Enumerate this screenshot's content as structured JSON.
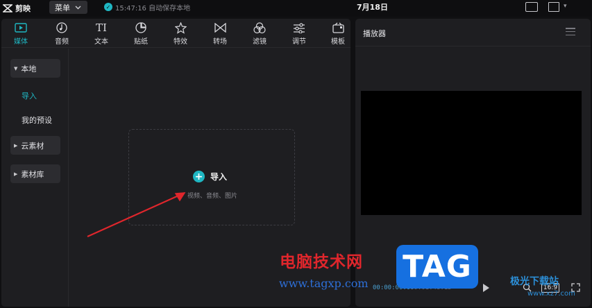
{
  "app": {
    "name": "剪映",
    "menu_label": "菜单",
    "save_status": "15:47:16 自动保存本地",
    "date": "7月18日"
  },
  "tabs": [
    {
      "label": "媒体",
      "icon": "media-icon",
      "active": true
    },
    {
      "label": "音频",
      "icon": "audio-icon"
    },
    {
      "label": "文本",
      "icon": "text-icon"
    },
    {
      "label": "贴纸",
      "icon": "sticker-icon"
    },
    {
      "label": "特效",
      "icon": "effects-icon"
    },
    {
      "label": "转场",
      "icon": "transition-icon"
    },
    {
      "label": "滤镜",
      "icon": "filter-icon"
    },
    {
      "label": "调节",
      "icon": "adjust-icon"
    },
    {
      "label": "模板",
      "icon": "template-icon"
    }
  ],
  "sidebar": {
    "local": "本地",
    "import": "导入",
    "presets": "我的预设",
    "cloud": "云素材",
    "library": "素材库"
  },
  "import_area": {
    "button_label": "导入",
    "hint": "视频、音频、图片"
  },
  "player": {
    "title": "播放器",
    "current_time": "00:00:00:00",
    "total_time": "00:01:46:15",
    "ratio": "16:9"
  },
  "watermark": {
    "site_name": "电脑技术网",
    "url": "www.tagxp.com",
    "tag": "TAG",
    "corner_text": "极光下载站",
    "corner_url": "www.xz7.com"
  },
  "colors": {
    "accent": "#1fb7c3",
    "background": "#101012",
    "panel": "#1e1e21",
    "watermark_red": "#e0262c",
    "watermark_blue": "#1670e0"
  }
}
